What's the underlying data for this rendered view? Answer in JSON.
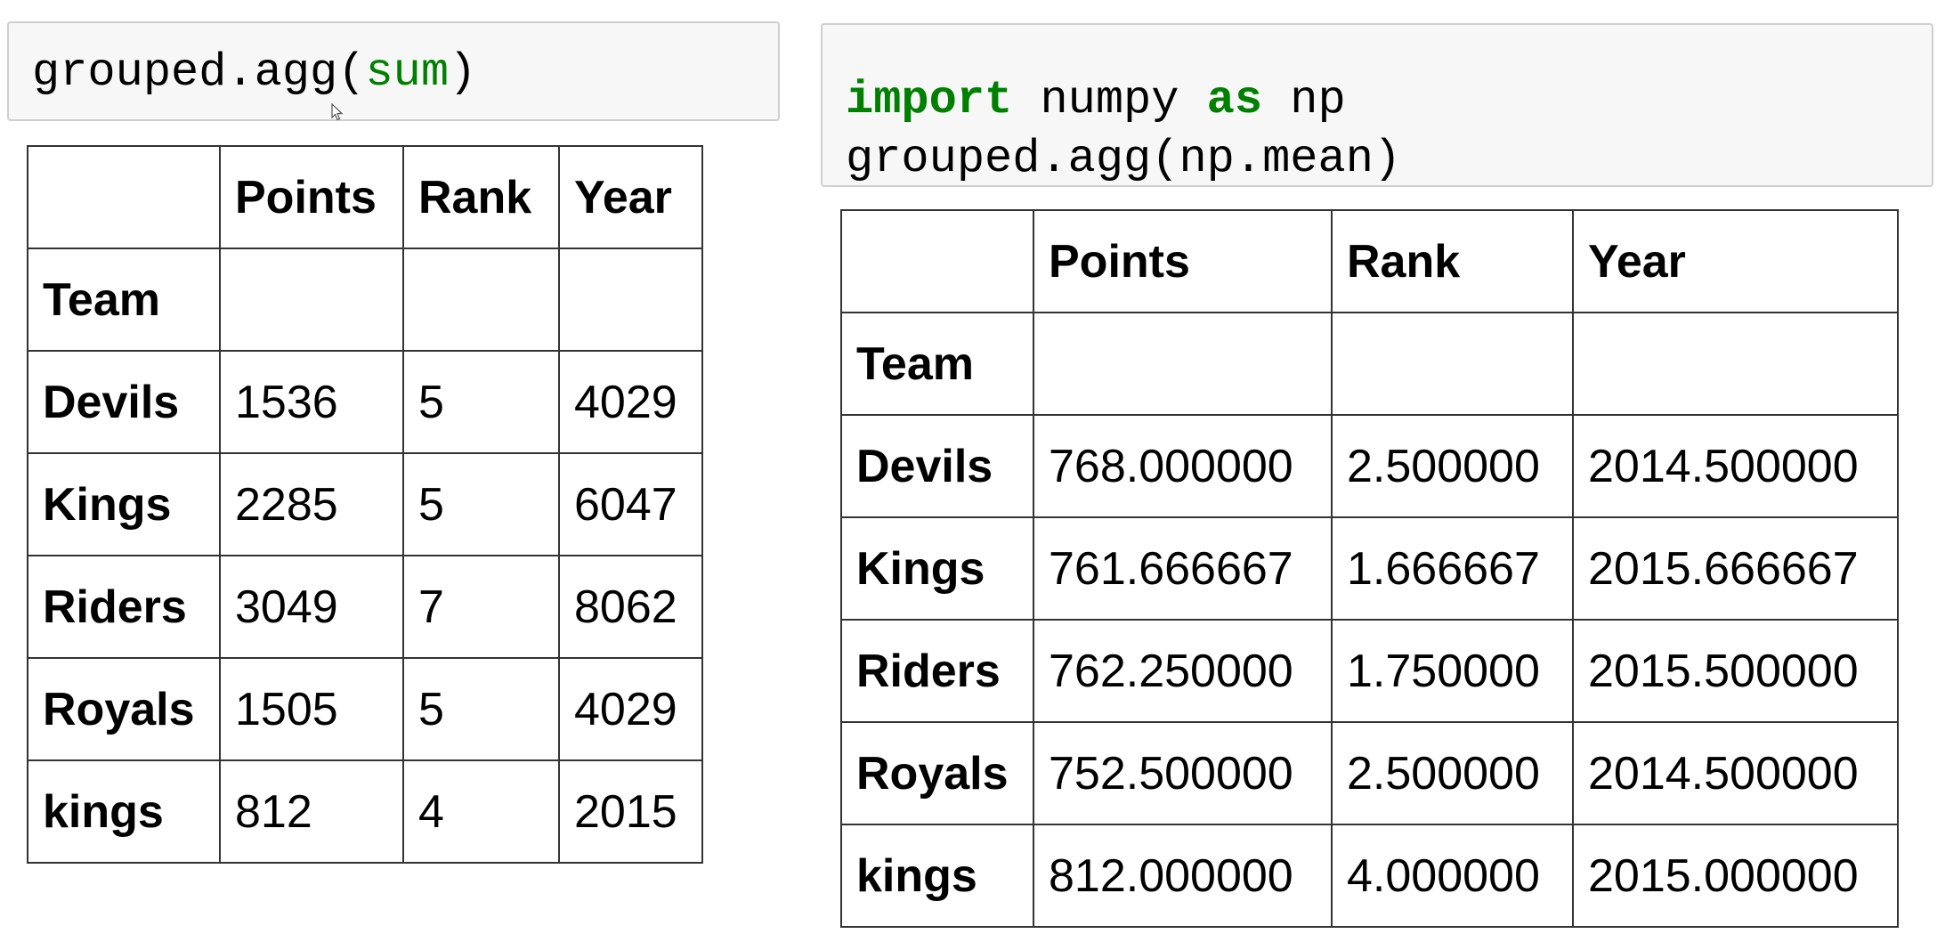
{
  "left_cell": {
    "code_prefix": "grouped.agg(",
    "code_builtin": "sum",
    "code_suffix": ")"
  },
  "right_cell": {
    "line1": {
      "kw_import": "import",
      "module": " numpy ",
      "kw_as": "as",
      "alias": " np"
    },
    "line2": "grouped.agg(np.mean)"
  },
  "left_table": {
    "columns": [
      "Points",
      "Rank",
      "Year"
    ],
    "index_name": "Team",
    "rows": [
      {
        "team": "Devils",
        "points": "1536",
        "rank": "5",
        "year": "4029"
      },
      {
        "team": "Kings",
        "points": "2285",
        "rank": "5",
        "year": "6047"
      },
      {
        "team": "Riders",
        "points": "3049",
        "rank": "7",
        "year": "8062"
      },
      {
        "team": "Royals",
        "points": "1505",
        "rank": "5",
        "year": "4029"
      },
      {
        "team": "kings",
        "points": "812",
        "rank": "4",
        "year": "2015"
      }
    ]
  },
  "right_table": {
    "columns": [
      "Points",
      "Rank",
      "Year"
    ],
    "index_name": "Team",
    "rows": [
      {
        "team": "Devils",
        "points": "768.000000",
        "rank": "2.500000",
        "year": "2014.500000"
      },
      {
        "team": "Kings",
        "points": "761.666667",
        "rank": "1.666667",
        "year": "2015.666667"
      },
      {
        "team": "Riders",
        "points": "762.250000",
        "rank": "1.750000",
        "year": "2015.500000"
      },
      {
        "team": "Royals",
        "points": "752.500000",
        "rank": "2.500000",
        "year": "2014.500000"
      },
      {
        "team": "kings",
        "points": "812.000000",
        "rank": "4.000000",
        "year": "2015.000000"
      }
    ]
  },
  "colors": {
    "keyword": "#008000",
    "cell_background": "#f7f7f7",
    "cell_border": "#cfcfcf",
    "table_border": "#333333"
  },
  "icons": {
    "cursor": "mouse-pointer-icon"
  }
}
